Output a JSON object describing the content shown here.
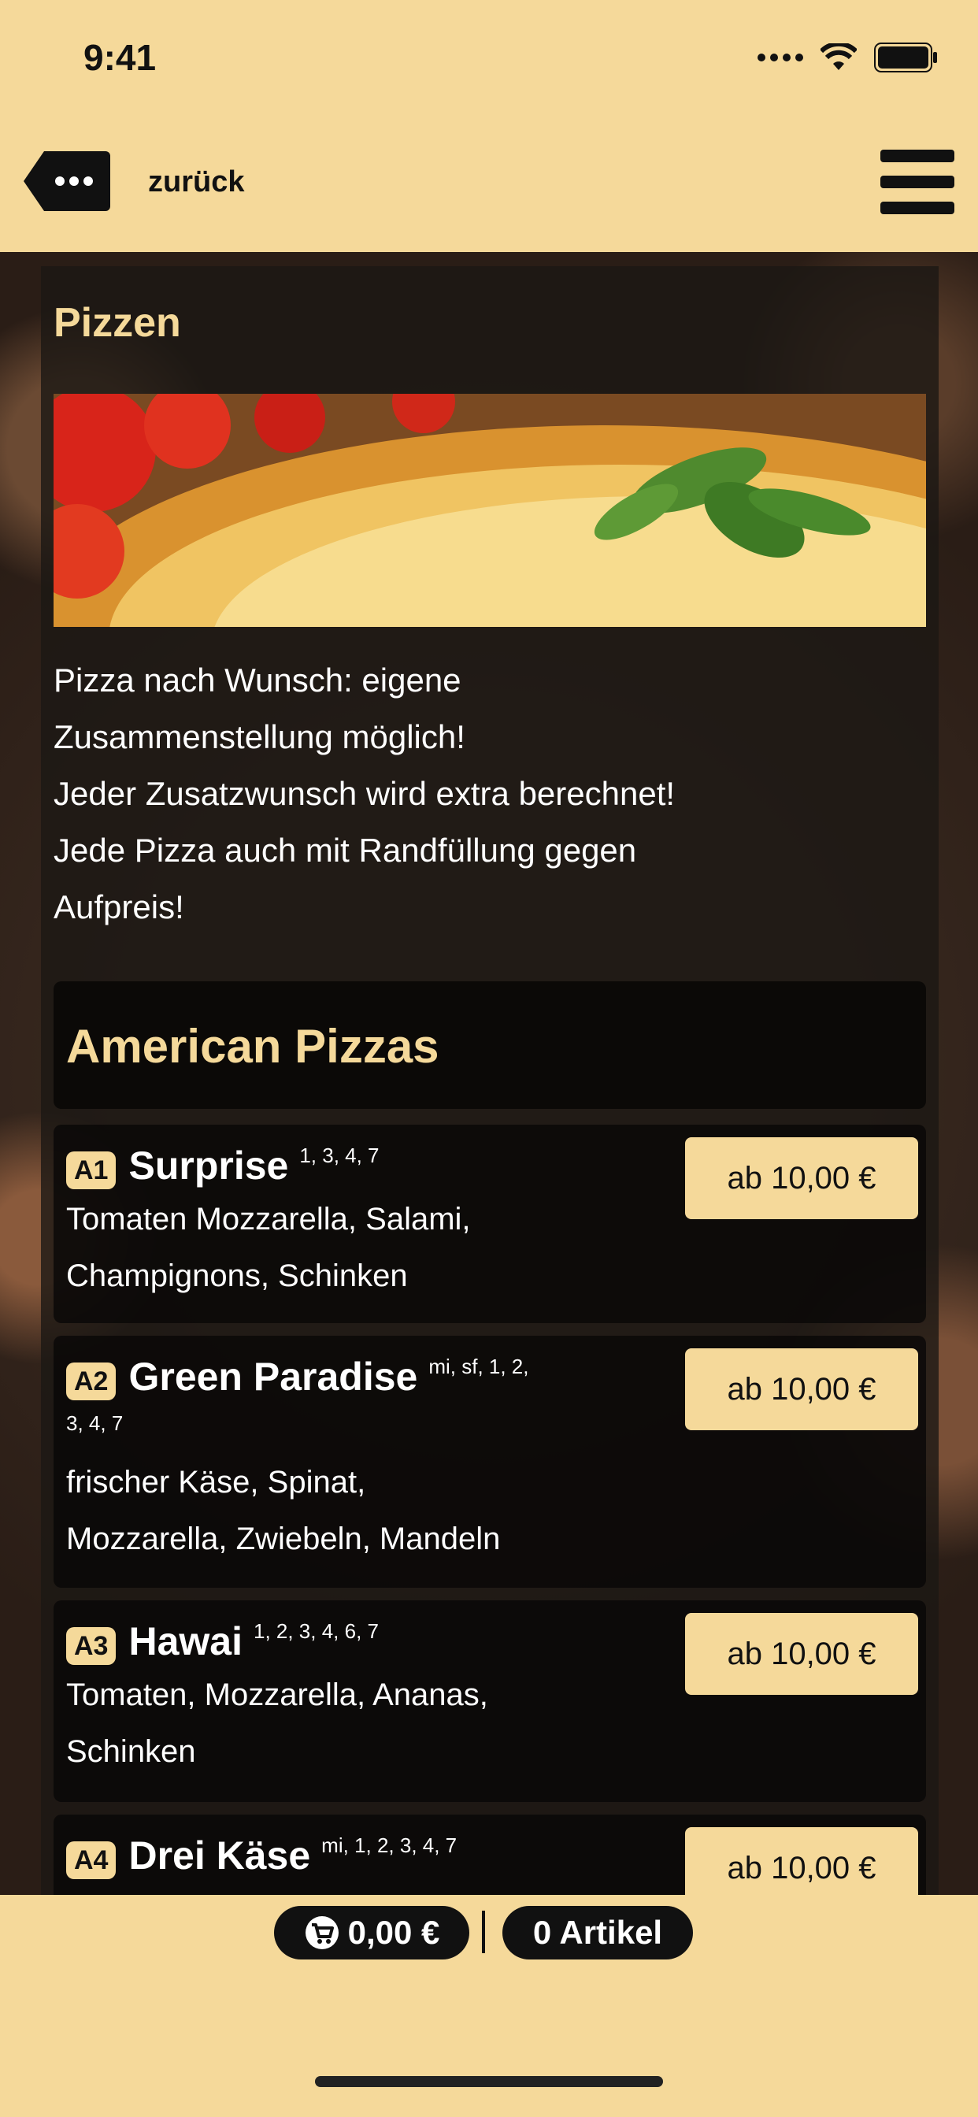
{
  "status_bar": {
    "time": "9:41"
  },
  "nav": {
    "back_label": "zurück"
  },
  "page": {
    "section_title": "Pizzen",
    "intro_lines": [
      "Pizza nach Wunsch: eigene",
      "Zusammenstellung möglich!",
      "Jeder Zusatzwunsch wird extra berechnet!",
      "Jede Pizza auch mit Randfüllung gegen",
      "Aufpreis!"
    ],
    "category_title": "American Pizzas",
    "items": [
      {
        "code": "A1",
        "name": "Surprise",
        "allergens": "1, 3, 4, 7",
        "allergens_cont": "",
        "desc_lines": [
          "Tomaten Mozzarella, Salami,",
          "Champignons, Schinken"
        ],
        "price": "ab 10,00 €"
      },
      {
        "code": "A2",
        "name": "Green Paradise",
        "allergens": "mi, sf, 1, 2,",
        "allergens_cont": "3, 4, 7",
        "desc_lines": [
          "frischer Käse, Spinat,",
          "Mozzarella, Zwiebeln, Mandeln"
        ],
        "price": "ab 10,00 €"
      },
      {
        "code": "A3",
        "name": "Hawai",
        "allergens": "1, 2, 3, 4, 6, 7",
        "allergens_cont": "",
        "desc_lines": [
          "Tomaten, Mozzarella, Ananas,",
          "Schinken"
        ],
        "price": "ab 10,00 €"
      },
      {
        "code": "A4",
        "name": "Drei Käse",
        "allergens": "mi, 1, 2, 3, 4, 7",
        "allergens_cont": "",
        "desc_lines": [],
        "price": "ab 10,00 €"
      }
    ]
  },
  "cart": {
    "total": "0,00 €",
    "count": "0 Artikel"
  },
  "colors": {
    "accent": "#f5d99a",
    "dark": "#111111"
  }
}
